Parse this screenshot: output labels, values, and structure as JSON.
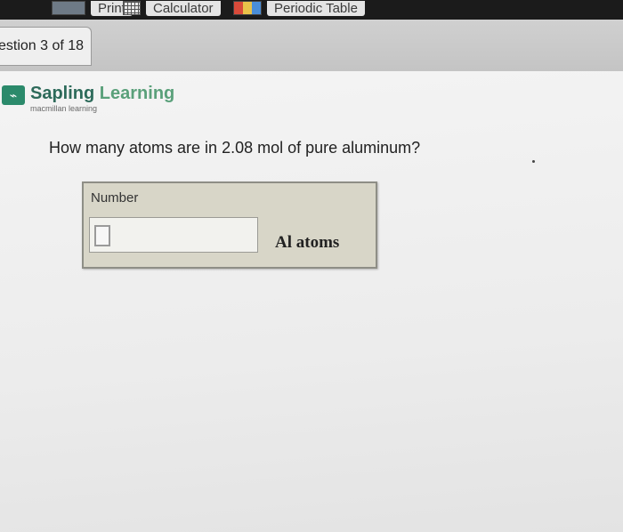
{
  "toolbar": {
    "items": [
      {
        "label": "Print",
        "icon": "printer-icon"
      },
      {
        "label": "Calculator",
        "icon": "calculator-icon"
      },
      {
        "label": "Periodic Table",
        "icon": "periodic-table-icon"
      }
    ]
  },
  "question_nav": {
    "label": "estion 3 of 18"
  },
  "brand": {
    "name_part1": "Sapling",
    "name_part2": "Learning",
    "subtitle": "macmillan learning",
    "icon": "sapling-logo-icon"
  },
  "question": {
    "text": "How many atoms are in 2.08 mol of pure aluminum?"
  },
  "answer": {
    "label": "Number",
    "value": "",
    "unit": "Al  atoms"
  }
}
